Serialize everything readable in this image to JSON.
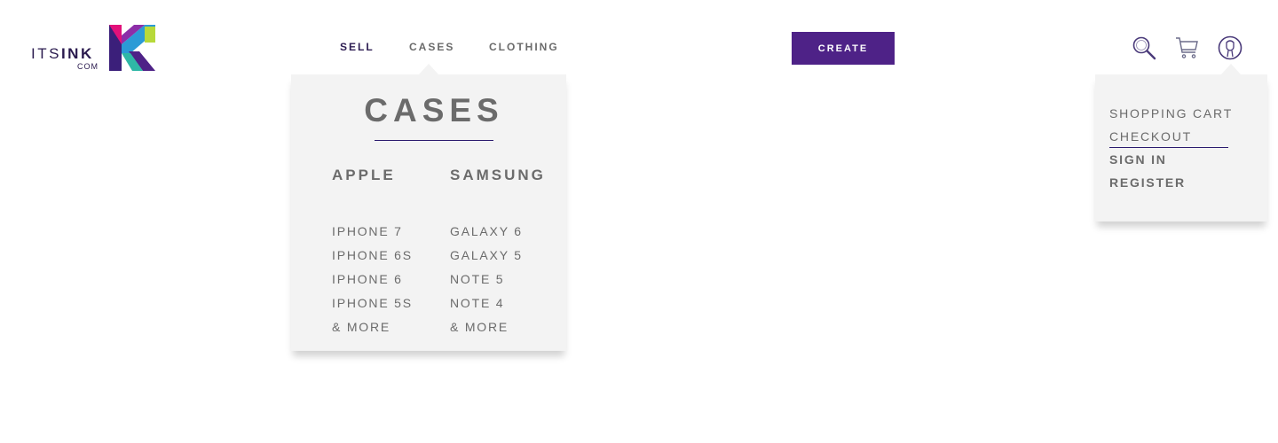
{
  "logo": {
    "text_light": "ITS",
    "text_bold": "INK",
    "sub": "COM"
  },
  "nav": {
    "items": [
      {
        "label": "SELL"
      },
      {
        "label": "CASES"
      },
      {
        "label": "CLOTHING"
      }
    ],
    "create_label": "CREATE"
  },
  "icons": {
    "search": "search-icon",
    "cart": "cart-icon",
    "account": "user-icon"
  },
  "cases_menu": {
    "title": "CASES",
    "columns": [
      {
        "heading": "APPLE",
        "items": [
          "IPHONE 7",
          "IPHONE 6S",
          "IPHONE 6",
          "IPHONE 5S",
          "& MORE"
        ]
      },
      {
        "heading": "SAMSUNG",
        "items": [
          "GALAXY 6",
          "GALAXY 5",
          "NOTE 5",
          "NOTE 4",
          "& MORE"
        ]
      }
    ]
  },
  "account_menu": {
    "items": [
      "SHOPPING CART",
      "CHECKOUT",
      "SIGN IN",
      "REGISTER"
    ]
  },
  "colors": {
    "accent": "#4e2287",
    "menu_bg": "#f3f3f3",
    "text": "#6b6b6b",
    "nav_active": "#2d1d52"
  }
}
